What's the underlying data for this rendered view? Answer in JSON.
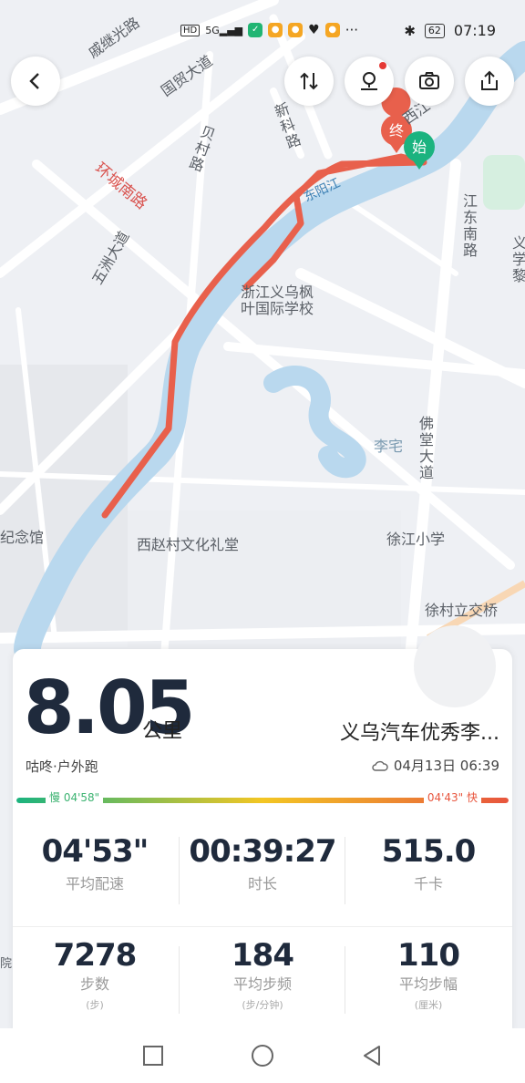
{
  "status_bar": {
    "network": "HD",
    "signal_label": "5G",
    "battery": "62",
    "time": "07:19",
    "more": "···"
  },
  "map": {
    "labels": {
      "qijiguang": "戚继光路",
      "guomao": "国贸大道",
      "huancheng": "环城南路",
      "beicun": "贝村路",
      "xinke": "新科路",
      "xijiang": "西江",
      "wuzhou": "五洲大道",
      "dongyang": "东阳江",
      "school": "浙江义乌枫\n叶国际学校",
      "jiangdong": "江东南路",
      "yi_edge": "义",
      "xue_edge": "学",
      "li_edge": "黎",
      "lizhai": "李宅",
      "fotang": "佛堂大道",
      "xujiang_school": "徐江小学",
      "xicun_hall": "西赵村文化礼堂",
      "memorial": "纪念馆",
      "xucun": "徐村立交桥",
      "edge_left": "院"
    },
    "start_marker": "始",
    "end_marker": "终"
  },
  "summary": {
    "distance": "8.05",
    "distance_unit": "公里",
    "runner_name": "义乌汽车优秀李...",
    "source": "咕咚·户外跑",
    "datetime": "04月13日 06:39",
    "pace_slow": "慢 04'58\"",
    "pace_fast": "04'43\" 快"
  },
  "stats_row1": [
    {
      "value": "04'53\"",
      "label": "平均配速"
    },
    {
      "value": "00:39:27",
      "label": "时长"
    },
    {
      "value": "515.0",
      "label": "千卡"
    }
  ],
  "stats_row2": [
    {
      "value": "7278",
      "label": "步数",
      "sub": "(步)"
    },
    {
      "value": "184",
      "label": "平均步频",
      "sub": "(步/分钟)"
    },
    {
      "value": "110",
      "label": "平均步幅",
      "sub": "(厘米)"
    }
  ],
  "colors": {
    "route": "#e8604c",
    "river": "#b9d8ee",
    "start": "#1bb37f",
    "end": "#e8604c"
  }
}
